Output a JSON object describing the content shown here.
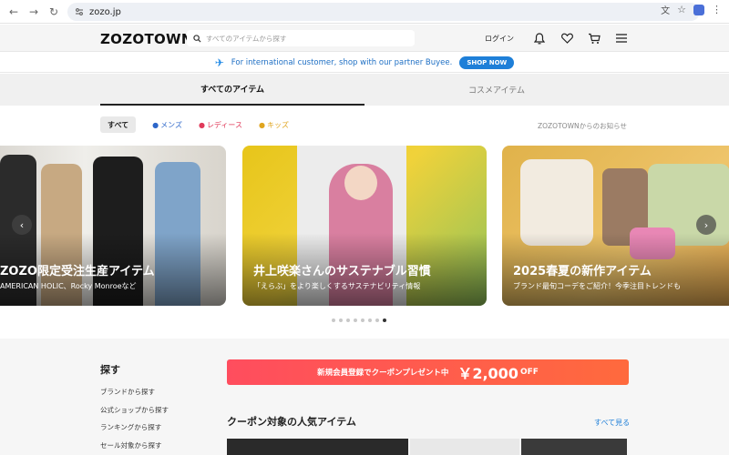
{
  "browser": {
    "url": "zozo.jp",
    "back_icon": "arrow-left-icon",
    "forward_icon": "arrow-right-icon",
    "reload_icon": "reload-icon"
  },
  "header": {
    "logo": "ZOZOTOWN",
    "search_placeholder": "すべてのアイテムから探す",
    "login": "ログイン"
  },
  "promo": {
    "text": "For international customer, shop with our partner Buyee.",
    "button": "SHOP NOW"
  },
  "tabs": [
    {
      "label": "すべてのアイテム",
      "active": true
    },
    {
      "label": "コスメアイテム",
      "active": false
    }
  ],
  "filters": {
    "all": "すべて",
    "mens": "メンズ",
    "ladies": "レディース",
    "kids": "キッズ"
  },
  "notice": "ZOZOTOWNからのお知らせ",
  "slides": [
    {
      "title": "ZOZO限定受注生産アイテム",
      "subtitle": "AMERICAN HOLIC、Rocky Monroeなど"
    },
    {
      "title": "井上咲楽さんのサステナブル習慣",
      "subtitle": "「えらぶ」をより楽しくするサステナビリティ情報"
    },
    {
      "title": "2025春夏の新作アイテム",
      "subtitle": "ブランド最旬コーデをご紹介！今季注目トレンドも"
    }
  ],
  "carousel": {
    "total_dots": 8,
    "active_dot": 8
  },
  "sidebar": {
    "title": "探す",
    "links": [
      "ブランドから探す",
      "公式ショップから探す",
      "ランキングから探す",
      "セール対象から探す"
    ]
  },
  "coupon": {
    "text": "新規会員登録でクーポンプレゼント中",
    "amount": "￥2,000",
    "suffix": "OFF"
  },
  "popular": {
    "title": "クーポン対象の人気アイテム",
    "see_all": "すべて見る"
  },
  "colors": {
    "accent_blue": "#1e7fd8",
    "coupon_red": "#ff4d5e",
    "mens": "#2c66c9",
    "ladies": "#e03a5a",
    "kids": "#e0a51f"
  }
}
